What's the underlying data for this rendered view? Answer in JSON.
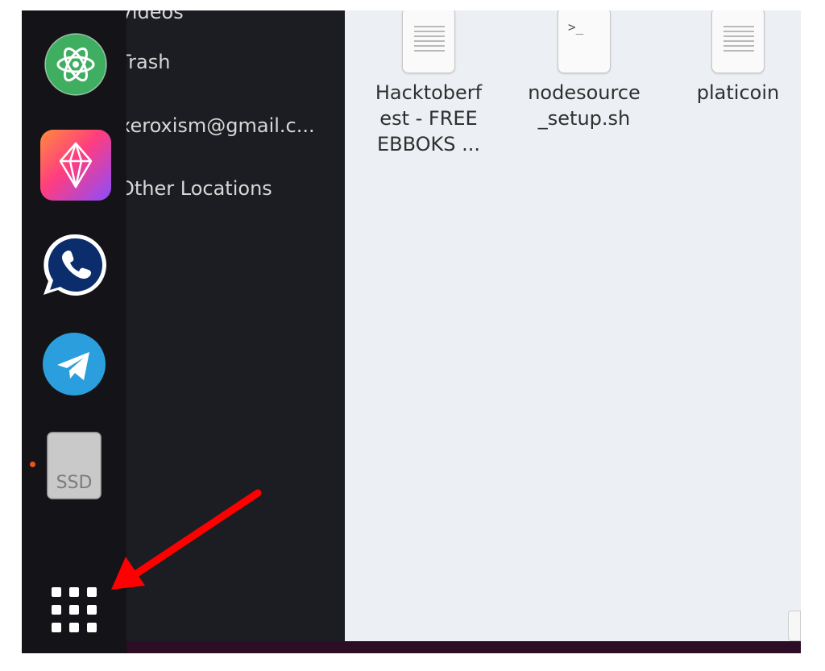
{
  "sidebar": {
    "items": [
      {
        "label": "Videos"
      },
      {
        "label": "Trash"
      },
      {
        "label": "xeroxism@gmail.c..."
      },
      {
        "label": "Other Locations"
      }
    ]
  },
  "files": [
    {
      "name": "Hacktoberf\nest - FREE\nEBBOKS ...",
      "icon": "text-document-icon"
    },
    {
      "name": "nodesource\n_setup.sh",
      "icon": "shell-script-icon"
    },
    {
      "name": "platicoin",
      "icon": "text-document-icon"
    }
  ],
  "dock": {
    "apps": [
      {
        "name": "atom-icon"
      },
      {
        "name": "app-gem-icon"
      },
      {
        "name": "whatsapp-icon"
      },
      {
        "name": "telegram-icon"
      },
      {
        "name": "ssd-drive-icon",
        "label": "SSD",
        "running": true
      }
    ],
    "show_applications_icon": "grid-icon"
  },
  "annotation": {
    "type": "red-arrow",
    "points_to": "show-applications-button",
    "color": "#ff0000"
  },
  "colors": {
    "sidebar_bg": "#1c1d22",
    "dock_bg": "#141317",
    "content_bg": "#eceff3",
    "running_indicator": "#e95420"
  }
}
